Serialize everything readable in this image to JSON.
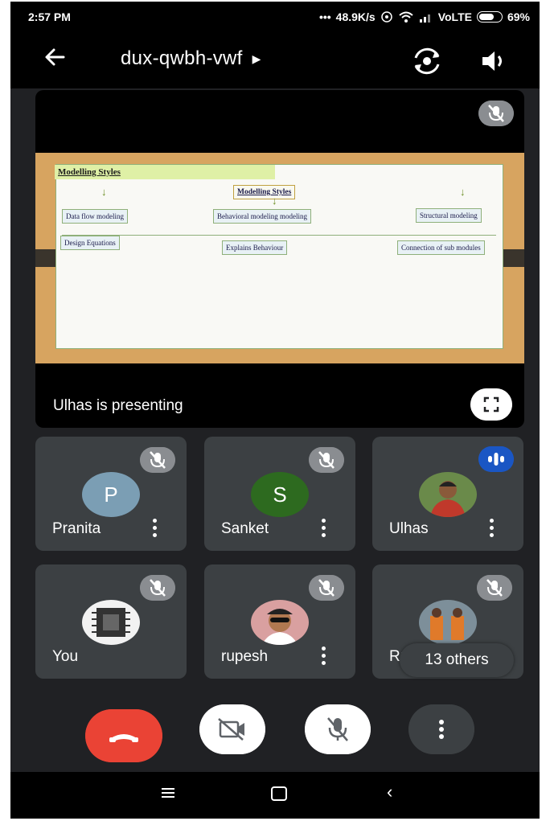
{
  "status_bar": {
    "time": "2:57 PM",
    "network_speed": "48.9K/s",
    "carrier": "VoLTE",
    "battery": "69%"
  },
  "header": {
    "meeting_code": "dux-qwbh-vwf",
    "icons": [
      "back-arrow-icon",
      "caret-right-icon",
      "flip-camera-icon",
      "speaker-icon"
    ]
  },
  "presentation": {
    "presenter_label": "Ulhas is presenting",
    "slide": {
      "title": "Modelling Styles",
      "center_box": "Modelling Styles",
      "items": [
        "Data flow modeling",
        "Behavioral modeling modeling",
        "Structural modeling"
      ],
      "sub_items": [
        "Design Equations",
        "Explains Behaviour",
        "Connection of sub modules"
      ]
    }
  },
  "participants": [
    {
      "name": "Pranita",
      "initial": "P",
      "avatar_color": "#7b9eb4",
      "muted": true,
      "has_menu": true
    },
    {
      "name": "Sanket",
      "initial": "S",
      "avatar_color": "#2d6a1f",
      "muted": true,
      "has_menu": true
    },
    {
      "name": "Ulhas",
      "initial": "",
      "avatar_color": "",
      "muted": false,
      "speaking": true,
      "has_menu": true
    },
    {
      "name": "You",
      "initial": "",
      "avatar_color": "",
      "muted": true,
      "has_menu": false
    },
    {
      "name": "rupesh",
      "initial": "",
      "avatar_color": "",
      "muted": true,
      "has_menu": true
    },
    {
      "name": "Rutuja",
      "initial": "",
      "avatar_color": "",
      "muted": true,
      "has_menu": false
    }
  ],
  "others_pill": "13 others",
  "controls": {
    "icons": [
      "end-call-icon",
      "camera-off-icon",
      "mic-off-icon",
      "more-vert-icon"
    ]
  },
  "nav_bar": {
    "icons": [
      "menu-icon",
      "home-icon",
      "back-icon"
    ]
  },
  "colors": {
    "background": "#202124",
    "tile": "#3c4043",
    "end_call": "#ea4335",
    "speaking": "#1a56c4",
    "mute_badge": "#5f6368"
  }
}
